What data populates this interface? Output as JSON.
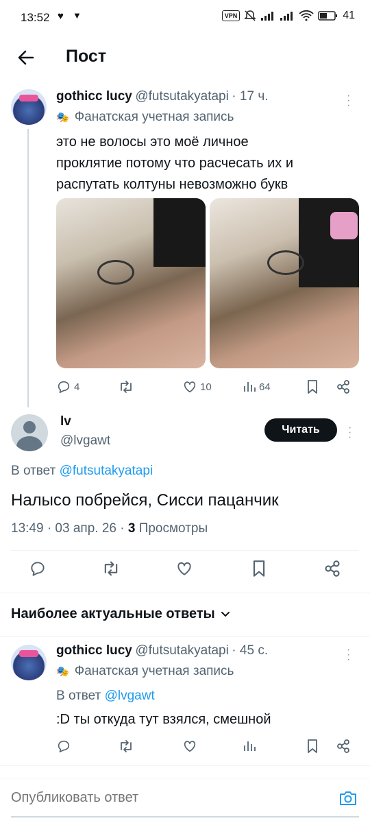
{
  "status_bar": {
    "time": "13:52",
    "vpn": "VPN",
    "battery": "41"
  },
  "header": {
    "title": "Пост"
  },
  "parent_tweet": {
    "name": "gothicc lucy",
    "handle": "@futsutakyatapi",
    "time": "· 17 ч.",
    "label": "Фанатская учетная запись",
    "text_lines": [
      "это не волосы это моё личное",
      "проклятие потому что расчесать их и",
      "распутать колтуны невозможно букв"
    ],
    "replies": "4",
    "likes": "10",
    "views": "64"
  },
  "main_tweet": {
    "name": "lv",
    "handle": "@lvgawt",
    "follow_label": "Читать",
    "reply_prefix": "В ответ ",
    "reply_to": "@futsutakyatapi",
    "text": "Налысо побрейся, Сисси пацанчик",
    "meta_time": "13:49 · 03 апр. 26 · ",
    "meta_views_count": "3",
    "meta_views_label": " Просмотры"
  },
  "sort": {
    "label": "Наиболее актуальные ответы"
  },
  "reply_tweet": {
    "name": "gothicc lucy",
    "handle": "@futsutakyatapi",
    "time": "· 45 с.",
    "label": "Фанатская учетная запись",
    "reply_prefix": "В ответ ",
    "reply_to": "@lvgawt",
    "text": ":D ты откуда тут взялся, смешной"
  },
  "composer": {
    "placeholder": "Опубликовать ответ"
  },
  "colors": {
    "accent": "#1d9bf0",
    "text": "#0f1419",
    "muted": "#536471"
  }
}
